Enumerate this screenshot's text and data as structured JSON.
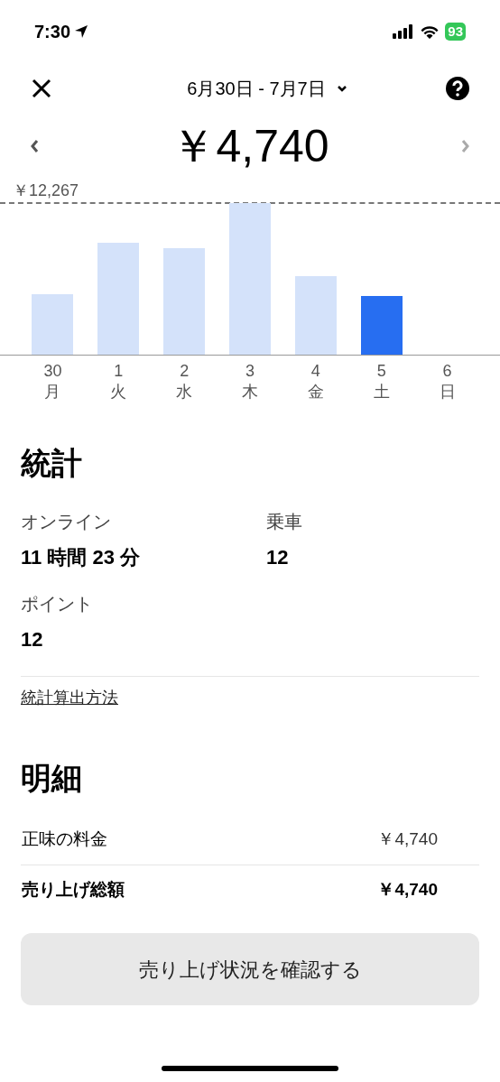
{
  "status_bar": {
    "time": "7:30",
    "battery": "93"
  },
  "header": {
    "date_range": "6月30日 - 7月7日"
  },
  "amount": "￥4,740",
  "chart": {
    "max_label": "￥12,267",
    "days": [
      {
        "date": "30",
        "weekday": "月",
        "selected": false
      },
      {
        "date": "1",
        "weekday": "火",
        "selected": false
      },
      {
        "date": "2",
        "weekday": "水",
        "selected": false
      },
      {
        "date": "3",
        "weekday": "木",
        "selected": false
      },
      {
        "date": "4",
        "weekday": "金",
        "selected": false
      },
      {
        "date": "5",
        "weekday": "土",
        "selected": true
      },
      {
        "date": "6",
        "weekday": "日",
        "selected": false
      }
    ]
  },
  "stats": {
    "title": "統計",
    "items": [
      {
        "label": "オンライン",
        "value": "11 時間 23 分"
      },
      {
        "label": "乗車",
        "value": "12"
      },
      {
        "label": "ポイント",
        "value": "12"
      }
    ],
    "link": "統計算出方法"
  },
  "breakdown": {
    "title": "明細",
    "rows": [
      {
        "label": "正味の料金",
        "value": "￥4,740",
        "kind": "normal"
      },
      {
        "label": "売り上げ総額",
        "value": "￥4,740",
        "kind": "total"
      }
    ]
  },
  "button": "売り上げ状況を確認する"
}
